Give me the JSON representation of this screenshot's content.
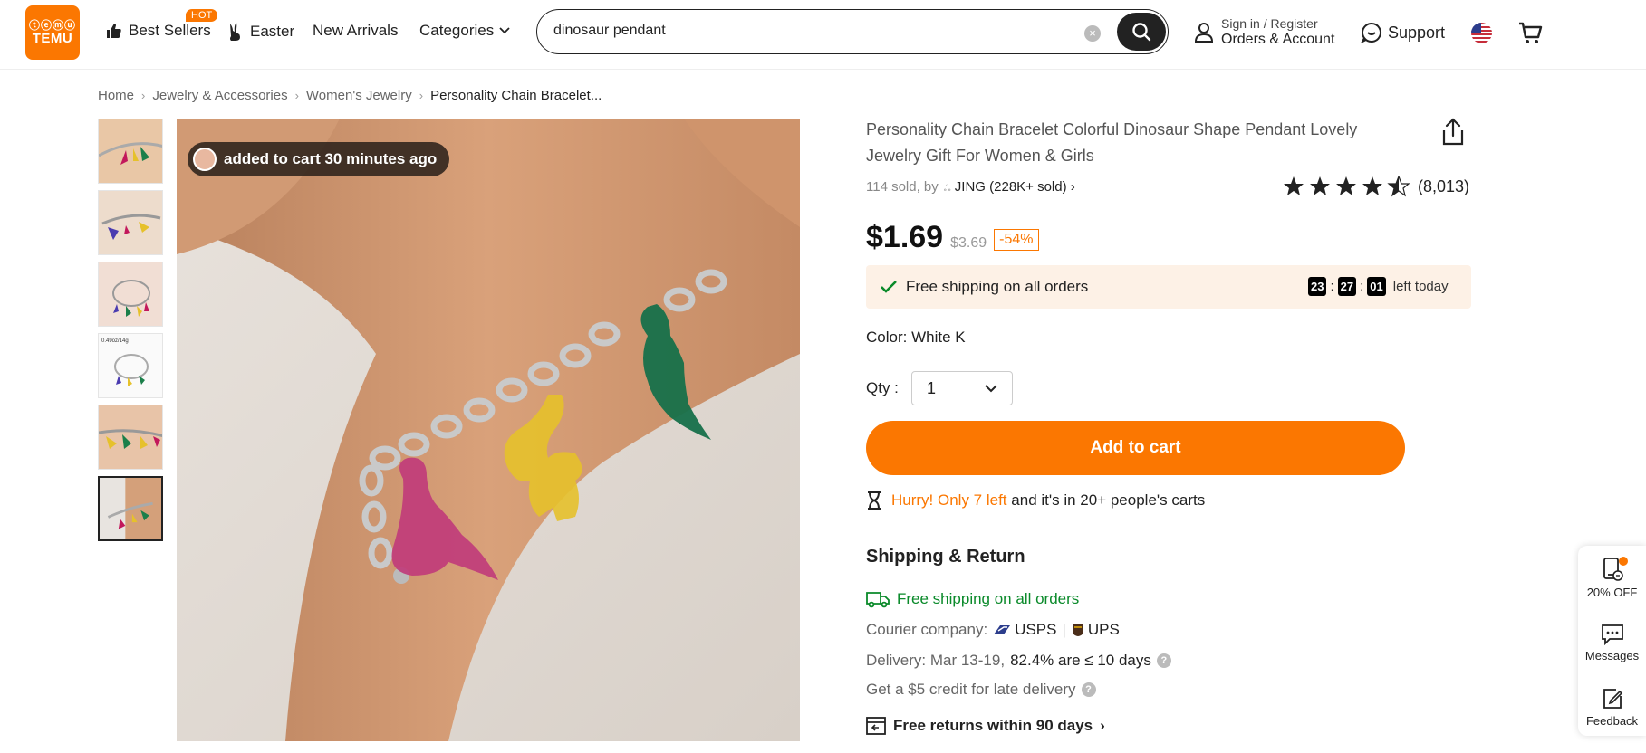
{
  "header": {
    "logo_top": "ⓣⓔⓜⓤ",
    "logo_word": "TEMU",
    "nav": {
      "best_sellers": "Best Sellers",
      "hot_badge": "HOT",
      "easter": "Easter",
      "new_arrivals": "New Arrivals",
      "categories": "Categories"
    },
    "search": {
      "value": "dinosaur pendant"
    },
    "account": {
      "line1": "Sign in / Register",
      "line2": "Orders & Account"
    },
    "support": "Support"
  },
  "breadcrumb": [
    "Home",
    "Jewelry & Accessories",
    "Women's Jewelry",
    "Personality Chain Bracelet..."
  ],
  "gallery": {
    "cart_notice": "added to cart 30 minutes ago",
    "thumb_caption": "0.49oz/14g"
  },
  "product": {
    "title": "Personality Chain Bracelet Colorful Dinosaur Shape Pendant Lovely Jewelry Gift For Women & Girls",
    "sold_prefix": "114 sold, by",
    "seller": "JING",
    "seller_sold": "(228K+ sold)",
    "rating": 4.5,
    "rating_count": "(8,013)",
    "price": "$1.69",
    "original_price": "$3.69",
    "discount": "-54%",
    "ship_banner": "Free shipping on all orders",
    "timer": {
      "h": "23",
      "m": "27",
      "s": "01",
      "note": "left today"
    },
    "color_label": "Color: White K",
    "qty_label": "Qty :",
    "qty_value": "1",
    "add_to_cart": "Add to cart",
    "hurry_orange": "Hurry! Only 7 left",
    "hurry_rest": "and it's in 20+ people's carts"
  },
  "shipping": {
    "title": "Shipping & Return",
    "free": "Free shipping on all orders",
    "courier_label": "Courier company:",
    "carrier1": "USPS",
    "carrier2": "UPS",
    "delivery_label": "Delivery: Mar 13-19,",
    "delivery_pct": "82.4% are ≤ 10 days",
    "credit": "Get a $5 credit for late delivery",
    "returns": "Free returns within 90 days"
  },
  "side_widget": {
    "off": "20% OFF",
    "messages": "Messages",
    "feedback": "Feedback"
  },
  "colors": {
    "accent": "#fb7701",
    "green": "#0a8a2a",
    "banner": "#fdf1e6"
  }
}
